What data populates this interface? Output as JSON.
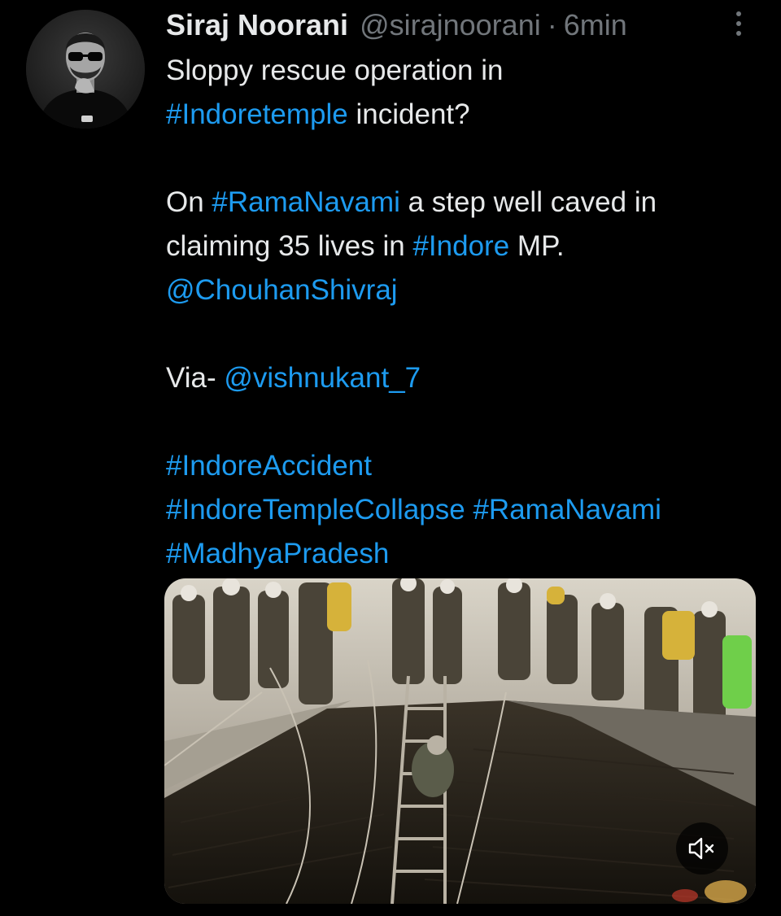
{
  "tweet": {
    "author": {
      "display_name": "Siraj Noorani",
      "handle": "@sirajnoorani",
      "separator": "·",
      "time": "6min"
    },
    "lines": {
      "l1": {
        "text": "Sloppy rescue operation in"
      },
      "l2": {
        "tag": "#Indoretemple",
        "after": " incident?"
      },
      "l3": {
        "before": "On ",
        "tag": "#RamaNavami",
        "after": " a step well caved in"
      },
      "l4": {
        "before": "claiming 35 lives in ",
        "tag": "#Indore",
        "after": " MP."
      },
      "l5": {
        "mention": "@ChouhanShivraj"
      },
      "l6": {
        "before": "Via- ",
        "mention": "@vishnukant_7"
      },
      "l7": {
        "tag": "#IndoreAccident"
      },
      "l8": {
        "tag1": "#IndoreTempleCollapse",
        "space": " ",
        "tag2": "#RamaNavami"
      },
      "l9": {
        "tag": "#MadhyaPradesh"
      }
    }
  },
  "colors": {
    "background": "#000000",
    "text_primary": "#e7e9ea",
    "text_secondary": "#71767b",
    "link": "#1d9bf0"
  },
  "icons": {
    "more": "more-vertical-icon",
    "mute": "volume-muted-icon"
  }
}
